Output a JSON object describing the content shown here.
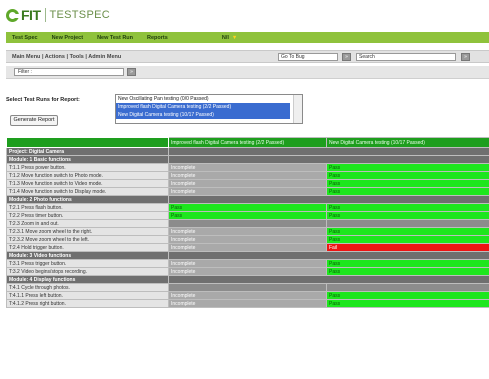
{
  "brand": {
    "name": "FIT",
    "product": "TESTSPEC"
  },
  "colors": {
    "nav_green": "#8fc23c",
    "pass": "#1ee61e",
    "fail": "#ee1414",
    "incomplete": "#a9a9a9",
    "header_green": "#1e9e1e"
  },
  "nav": {
    "items": [
      "Test Spec",
      "New Project",
      "New Test Run",
      "Reports"
    ],
    "alert": "N/I"
  },
  "toolbar": {
    "links": "Main Menu | Actions | Tools | Admin Menu",
    "goto_value": "Go To Bug",
    "go_button": "»",
    "search_value": "Search",
    "search_button": "»"
  },
  "filter": {
    "value": "Filter :",
    "button": "»"
  },
  "report": {
    "select_label": "Select Test Runs for Report:",
    "generate_button": "Generate Report",
    "options": [
      {
        "label": "New Oscillating Pan testing (0/0 Passed)",
        "selected": false
      },
      {
        "label": "Improved flash Digital Camera testing (2/2 Passed)",
        "selected": true
      },
      {
        "label": "New Digital Camera testing (10/17 Passed)",
        "selected": true
      }
    ]
  },
  "grid": {
    "columns": [
      "Improved flash Digital Camera testing (2/2 Passed)",
      "New Digital Camera testing (10/17 Passed)"
    ],
    "rows": [
      {
        "type": "project",
        "label": "Project: Digital Camera"
      },
      {
        "type": "module",
        "label": "Module: 1 Basic functions"
      },
      {
        "type": "test",
        "label": "T:1.1 Press power button.",
        "c1": "Incomplete",
        "c2": "Pass"
      },
      {
        "type": "test",
        "label": "T:1.2 Move function switch to Photo mode.",
        "c1": "Incomplete",
        "c2": "Pass"
      },
      {
        "type": "test",
        "label": "T:1.3 Move function switch to Video mode.",
        "c1": "Incomplete",
        "c2": "Pass"
      },
      {
        "type": "test",
        "label": "T:1.4 Move function switch to Display mode.",
        "c1": "Incomplete",
        "c2": "Pass"
      },
      {
        "type": "module",
        "label": "Module: 2 Photo functions"
      },
      {
        "type": "test",
        "label": "T:2.1 Press flash button.",
        "c1": "Pass",
        "c2": "Pass"
      },
      {
        "type": "test",
        "label": "T:2.2 Press timer button.",
        "c1": "Pass",
        "c2": "Pass"
      },
      {
        "type": "test",
        "label": "T:2.3 Zoom in and out.",
        "c1": "",
        "c2": ""
      },
      {
        "type": "test",
        "label": "T:2.3.1 Move zoom wheel to the right.",
        "c1": "Incomplete",
        "c2": "Pass"
      },
      {
        "type": "test",
        "label": "T:2.3.2 Move zoom wheel to the left.",
        "c1": "Incomplete",
        "c2": "Pass"
      },
      {
        "type": "test",
        "label": "T:2.4 Hold trigger button.",
        "c1": "Incomplete",
        "c2": "Fail"
      },
      {
        "type": "module",
        "label": "Module: 3 Video functions"
      },
      {
        "type": "test",
        "label": "T:3.1 Press trigger button.",
        "c1": "Incomplete",
        "c2": "Pass"
      },
      {
        "type": "test",
        "label": "T:3.2 Video begins/stops recording.",
        "c1": "Incomplete",
        "c2": "Pass"
      },
      {
        "type": "module",
        "label": "Module: 4 Display functions"
      },
      {
        "type": "test",
        "label": "T:4.1 Cycle through photos.",
        "c1": "",
        "c2": ""
      },
      {
        "type": "test",
        "label": "T:4.1.1 Press left button.",
        "c1": "Incomplete",
        "c2": "Pass"
      },
      {
        "type": "test",
        "label": "T:4.1.2 Press right button.",
        "c1": "Incomplete",
        "c2": "Pass"
      }
    ]
  }
}
